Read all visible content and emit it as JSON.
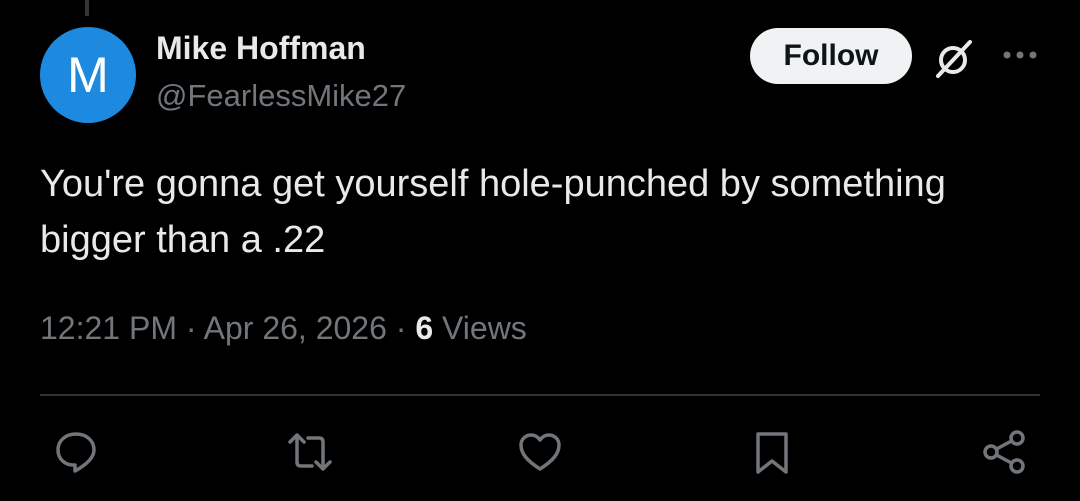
{
  "author": {
    "avatar_letter": "M",
    "display_name": "Mike Hoffman",
    "handle": "@FearlessMike27"
  },
  "header_actions": {
    "follow_label": "Follow",
    "grok_icon": "grok-icon",
    "more_icon": "more-icon"
  },
  "tweet": {
    "text": "You're gonna get yourself hole-punched by something bigger than a .22",
    "time": "12:21 PM",
    "date": "Apr 26, 2026",
    "separator": "·",
    "views_count": "6",
    "views_label": "Views"
  },
  "action_bar": {
    "icons": [
      "reply-icon",
      "retweet-icon",
      "like-icon",
      "bookmark-icon",
      "share-icon"
    ]
  },
  "colors": {
    "background": "#000000",
    "text_primary": "#e7e9ea",
    "text_secondary": "#71767b",
    "avatar": "#1d8ae0",
    "follow_button_bg": "#eff3f4",
    "divider": "#2f3336"
  }
}
